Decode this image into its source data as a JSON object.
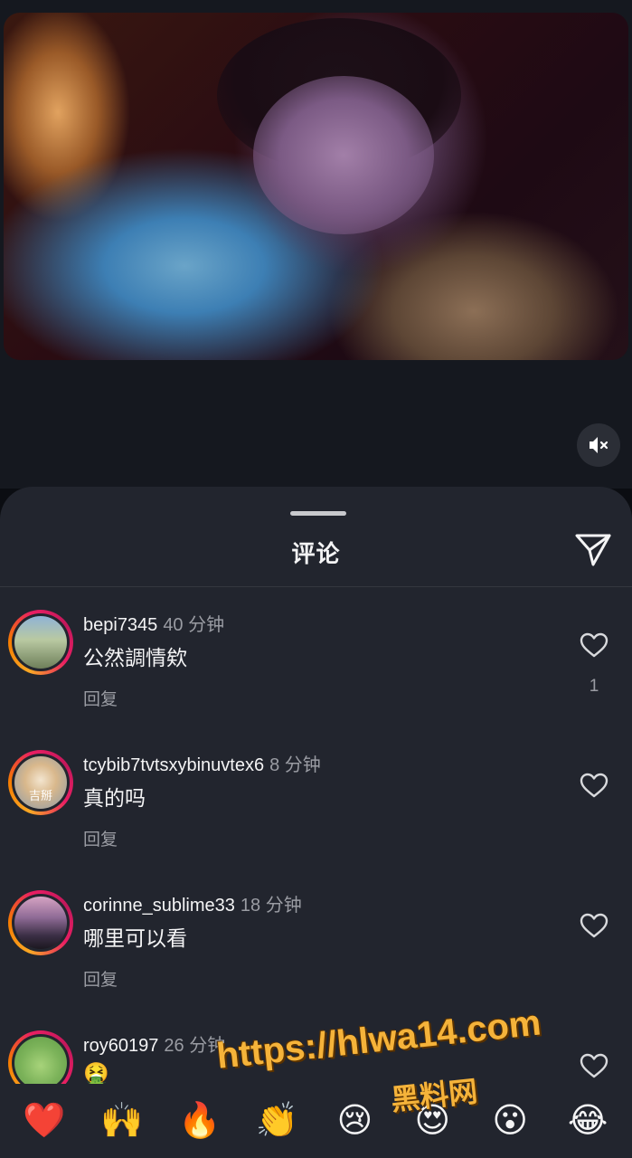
{
  "video": {
    "mute_icon": "speaker-muted-icon"
  },
  "comments_sheet": {
    "title": "评论",
    "share_icon": "send-paper-plane-icon",
    "comments": [
      {
        "username": "bepi7345",
        "time": "40 分钟",
        "text": "公然調情欸",
        "reply_label": "回复",
        "like_count": "1"
      },
      {
        "username": "tcybib7tvtsxybinuvtex6",
        "time": "8 分钟",
        "text": "真的吗",
        "reply_label": "回复",
        "avatar_caption": "吉掰"
      },
      {
        "username": "corinne_sublime33",
        "time": "18 分钟",
        "text": "哪里可以看",
        "reply_label": "回复"
      },
      {
        "username": "roy60197",
        "time": "26 分钟",
        "text": "🤮"
      }
    ]
  },
  "emoji_bar": [
    "❤️",
    "🙌",
    "🔥",
    "👏",
    "😢",
    "😍",
    "😮",
    "😂"
  ],
  "watermark": {
    "url": "https://hlwa14.com",
    "name": "黑料网"
  },
  "colors": {
    "sheet_background": "#22252e",
    "muted_text": "#9a9ca3",
    "watermark": "#f5b33a"
  }
}
